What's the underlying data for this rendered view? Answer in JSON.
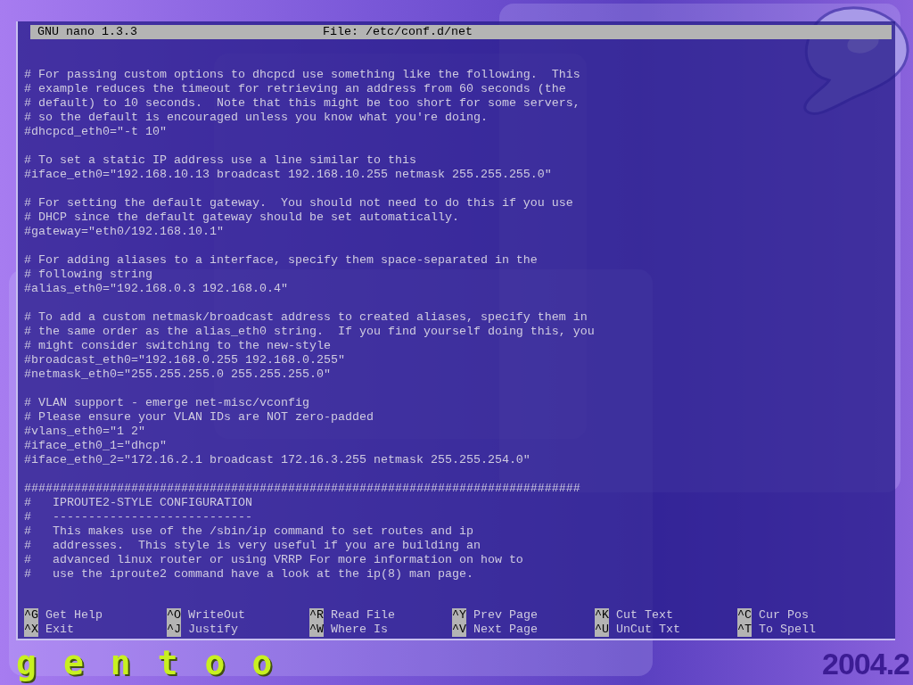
{
  "titlebar": {
    "program": "GNU nano 1.3.3",
    "file": "File: /etc/conf.d/net"
  },
  "buffer": {
    "blocks": [
      {
        "kind": "paragraph",
        "lines": [
          "# For passing custom options to dhcpcd use something like the following.  This",
          "# example reduces the timeout for retrieving an address from 60 seconds (the",
          "# default) to 10 seconds.  Note that this might be too short for some servers,",
          "# so the default is encouraged unless you know what you're doing.",
          "#dhcpcd_eth0=\"-t 10\""
        ]
      },
      {
        "kind": "paragraph",
        "lines": [
          "# To set a static IP address use a line similar to this",
          "#iface_eth0=\"192.168.10.13 broadcast 192.168.10.255 netmask 255.255.255.0\""
        ]
      },
      {
        "kind": "paragraph",
        "lines": [
          "# For setting the default gateway.  You should not need to do this if you use",
          "# DHCP since the default gateway should be set automatically.",
          "#gateway=\"eth0/192.168.10.1\""
        ]
      },
      {
        "kind": "paragraph",
        "lines": [
          "# For adding aliases to a interface, specify them space-separated in the",
          "# following string",
          "#alias_eth0=\"192.168.0.3 192.168.0.4\""
        ]
      },
      {
        "kind": "paragraph",
        "lines": [
          "# To add a custom netmask/broadcast address to created aliases, specify them in",
          "# the same order as the alias_eth0 string.  If you find yourself doing this, you",
          "# might consider switching to the new-style",
          "#broadcast_eth0=\"192.168.0.255 192.168.0.255\"",
          "#netmask_eth0=\"255.255.255.0 255.255.255.0\""
        ]
      },
      {
        "kind": "paragraph",
        "lines": [
          "# VLAN support - emerge net-misc/vconfig",
          "# Please ensure your VLAN IDs are NOT zero-padded",
          "#vlans_eth0=\"1 2\"",
          "#iface_eth0_1=\"dhcp\"",
          "#iface_eth0_2=\"172.16.2.1 broadcast 172.16.3.255 netmask 255.255.254.0\""
        ]
      },
      {
        "kind": "section",
        "lines": [
          "##############################################################################",
          "#   IPROUTE2-STYLE CONFIGURATION",
          "#   ----------------------------",
          "#   This makes use of the /sbin/ip command to set routes and ip",
          "#   addresses.  This style is very useful if you are building an",
          "#   advanced linux router or using VRRP For more information on how to",
          "#   use the iproute2 command have a look at the ip(8) man page."
        ]
      }
    ]
  },
  "shortcuts": [
    {
      "key": "^G",
      "label": "Get Help"
    },
    {
      "key": "^O",
      "label": "WriteOut"
    },
    {
      "key": "^R",
      "label": "Read File"
    },
    {
      "key": "^Y",
      "label": "Prev Page"
    },
    {
      "key": "^K",
      "label": "Cut Text"
    },
    {
      "key": "^C",
      "label": "Cur Pos"
    },
    {
      "key": "^X",
      "label": "Exit"
    },
    {
      "key": "^J",
      "label": "Justify"
    },
    {
      "key": "^W",
      "label": "Where Is"
    },
    {
      "key": "^V",
      "label": "Next Page"
    },
    {
      "key": "^U",
      "label": "UnCut Txt"
    },
    {
      "key": "^T",
      "label": "To Spell"
    }
  ],
  "desktop": {
    "logo_text": "gentoo",
    "version": "2004.2"
  }
}
